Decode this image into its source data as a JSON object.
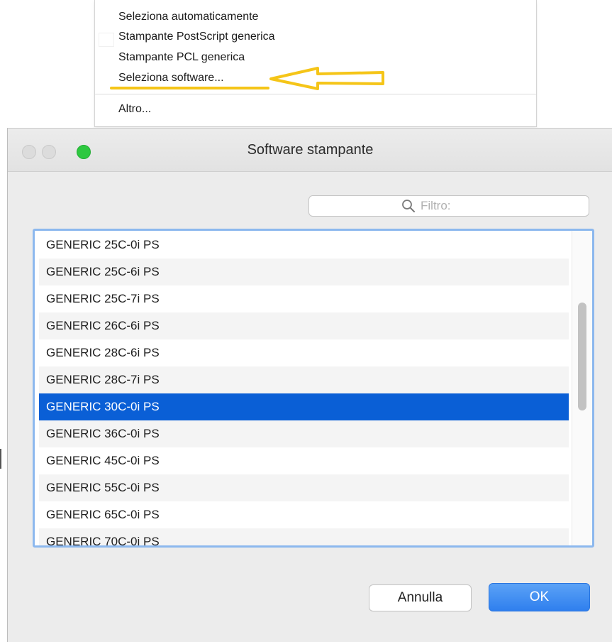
{
  "menu": {
    "items": [
      {
        "label": "Seleziona automaticamente"
      },
      {
        "label": "Stampante PostScript generica"
      },
      {
        "label": "Stampante PCL generica"
      },
      {
        "label": "Seleziona software..."
      },
      {
        "label": "Altro..."
      }
    ],
    "annotation_color": "#f5c518"
  },
  "window": {
    "title": "Software stampante",
    "search": {
      "placeholder": "Filtro:",
      "value": ""
    },
    "list": {
      "items": [
        "GENERIC 25C-0i PS",
        "GENERIC 25C-6i PS",
        "GENERIC 25C-7i PS",
        "GENERIC 26C-6i PS",
        "GENERIC 28C-6i PS",
        "GENERIC 28C-7i PS",
        "GENERIC 30C-0i PS",
        "GENERIC 36C-0i PS",
        "GENERIC 45C-0i PS",
        "GENERIC 55C-0i PS",
        "GENERIC 65C-0i PS",
        "GENERIC 70C-0i PS"
      ],
      "selected": "GENERIC 30C-0i PS",
      "selection_color": "#0a5fd6"
    },
    "buttons": {
      "cancel": "Annulla",
      "ok": "OK"
    }
  }
}
